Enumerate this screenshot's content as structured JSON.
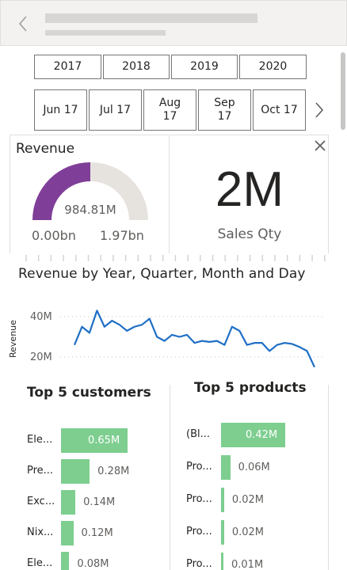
{
  "slicer": {
    "years": [
      "2017",
      "2018",
      "2019",
      "2020"
    ],
    "months": [
      "Jun 17",
      "Jul 17",
      "Aug 17",
      "Sep 17",
      "Oct 17"
    ]
  },
  "gauge": {
    "title": "Revenue",
    "value": "984.81M",
    "min": "0.00bn",
    "max": "1.97bn",
    "fill_fraction": 0.5,
    "fill_color": "#7f3f98",
    "track_color": "#e6e3df"
  },
  "kpi": {
    "value": "2M",
    "label": "Sales Qty"
  },
  "icons": {
    "back": "back-chevron-icon",
    "next": "chevron-right-icon",
    "close": "close-icon"
  },
  "chart_data": [
    {
      "type": "line",
      "title": "Revenue by Year, Quarter, Month and Day",
      "ylabel": "Revenue",
      "yticks": [
        "40M",
        "20M"
      ],
      "ylim": [
        10,
        48
      ],
      "grid": true,
      "color": "#1f6fc5",
      "values": [
        26,
        35,
        32,
        43,
        35,
        38,
        36,
        33,
        35,
        36,
        39,
        30,
        28,
        31,
        30,
        31,
        27,
        28,
        27.5,
        28,
        26,
        35,
        33,
        26,
        27,
        27,
        23,
        26,
        27,
        26.5,
        25,
        23,
        15
      ]
    },
    {
      "type": "bar",
      "title": "Top 5 customers",
      "categories": [
        "Ele...",
        "Pre...",
        "Exc...",
        "Nix...",
        "Ele..."
      ],
      "values": [
        0.65,
        0.28,
        0.14,
        0.12,
        0.08
      ],
      "labels": [
        "0.65M",
        "0.28M",
        "0.14M",
        "0.12M",
        "0.08M"
      ]
    },
    {
      "type": "bar",
      "title": "Top 5 products",
      "categories": [
        "(Bl...",
        "Pro...",
        "Pro...",
        "Pro...",
        "Pro..."
      ],
      "values": [
        0.42,
        0.06,
        0.02,
        0.02,
        0.01
      ],
      "labels": [
        "0.42M",
        "0.06M",
        "0.02M",
        "0.02M",
        "0.01M"
      ]
    }
  ]
}
